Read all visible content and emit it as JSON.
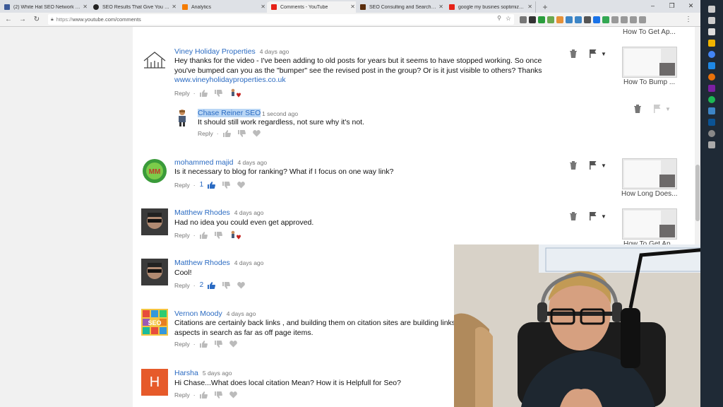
{
  "browser": {
    "tabs": [
      {
        "title": "(2) White Hat SEO Network by C",
        "color": "#3b5998"
      },
      {
        "title": "SEO Results That Give You a Fight",
        "color": "#222222"
      },
      {
        "title": "Analytics",
        "color": "#f57c00"
      },
      {
        "title": "Comments - YouTube",
        "color": "#e62117",
        "active": true
      },
      {
        "title": "SEO Consulting and Search Mark",
        "color": "#5a2d0c"
      },
      {
        "title": "google my busines soptimizatio",
        "color": "#e62117"
      }
    ],
    "new_tab_symbol": "+",
    "url_protocol": "https://",
    "url_rest": "www.youtube.com/comments"
  },
  "comments": [
    {
      "author": "Viney Holiday Properties",
      "time": "4 days ago",
      "text": "Hey thanks for the video - I've been adding to old posts for years but it seems to have stopped working. So once you've bumped can you as the \"bumper\" see the revised post in the group? Or is it just visible to others? Thanks",
      "link": "www.vineyholidayproperties.co.uk",
      "reply_label": "Reply",
      "video_title": "How To Bump ..."
    },
    {
      "author": "Chase Reiner SEO",
      "time": "1 second ago",
      "text": "It should still work regardless, not sure why it's not.",
      "reply_label": "Reply"
    },
    {
      "author": "mohammed majid",
      "time": "4 days ago",
      "text": "Is it necessary to blog for ranking? What if I focus on one way link?",
      "reply_label": "Reply",
      "likes": "1",
      "video_title": "How Long Does..."
    },
    {
      "author": "Matthew Rhodes",
      "time": "4 days ago",
      "text": "Had no idea you could even get approved.",
      "reply_label": "Reply",
      "video_title": "How To Get Ap..."
    },
    {
      "author": "Matthew Rhodes",
      "time": "4 days ago",
      "text": "Cool!",
      "reply_label": "Reply",
      "likes": "2"
    },
    {
      "author": "Vernon Moody",
      "time": "4 days ago",
      "text": "Citations are certainly back links , and building them on citation sites are building links aspects in search as far as off page items.",
      "reply_label": "Reply"
    },
    {
      "author": "Harsha",
      "time": "5 days ago",
      "text": "Hi Chase...What does local citation Mean? How it is Helpfull for Seo?",
      "reply_label": "Reply",
      "avatar_letter": "H"
    }
  ],
  "top_video_title": "How To Get Ap...",
  "separator": "·",
  "colors": {
    "link": "#2b6bc2",
    "avatar_h": "#e65a2a",
    "taskbar": "#1f2a36"
  },
  "icons": [
    "lock-icon",
    "star-icon",
    "trash-icon",
    "flag-icon",
    "thumbs-up-icon",
    "thumbs-down-icon",
    "heart-icon"
  ]
}
